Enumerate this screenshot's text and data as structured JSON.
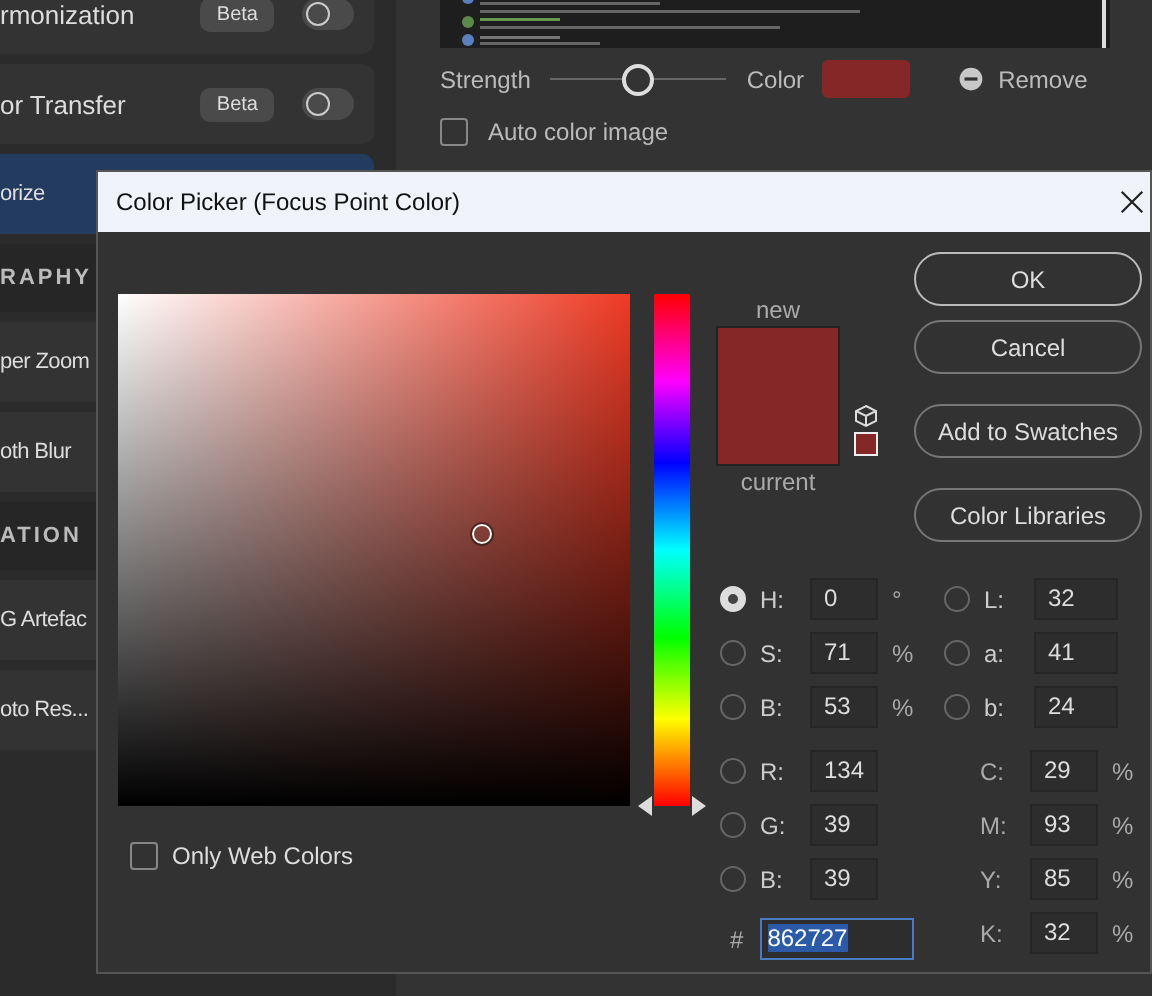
{
  "sidebar": {
    "items": [
      {
        "kind": "filter",
        "label": "rmonization",
        "badge": "Beta",
        "on": false,
        "selected": false
      },
      {
        "kind": "filter",
        "label": "or Transfer",
        "badge": "Beta",
        "on": false,
        "selected": false
      },
      {
        "kind": "filter",
        "label": "orize",
        "selected": true
      },
      {
        "kind": "header",
        "label": "RAPHY"
      },
      {
        "kind": "filter",
        "label": "per Zoom",
        "selected": false
      },
      {
        "kind": "filter",
        "label": "oth Blur",
        "selected": false
      },
      {
        "kind": "header",
        "label": "ATION"
      },
      {
        "kind": "filter",
        "label": "G Artefac",
        "selected": false
      },
      {
        "kind": "filter",
        "label": "oto Res...",
        "selected": false
      }
    ]
  },
  "panel": {
    "strength": {
      "label": "Strength",
      "level": 0.5
    },
    "color": {
      "label": "Color"
    },
    "remove_button": "Remove",
    "auto_color": {
      "label": "Auto color image",
      "checked": false
    }
  },
  "dialog": {
    "title": "Color Picker (Focus Point Color)",
    "swatch": {
      "new_label": "new",
      "current_label": "current"
    },
    "buttons": [
      {
        "label": "OK",
        "default": true
      },
      {
        "label": "Cancel",
        "default": false
      },
      {
        "label": "Add to Swatches",
        "default": false
      },
      {
        "label": "Color Libraries",
        "default": false
      }
    ],
    "fields_left": [
      {
        "kind": "radio",
        "label": "H:",
        "value": "0",
        "unit": "°",
        "selected": true
      },
      {
        "kind": "radio",
        "label": "S:",
        "value": "71",
        "unit": "%",
        "selected": false
      },
      {
        "kind": "radio",
        "label": "B:",
        "value": "53",
        "unit": "%",
        "selected": false
      },
      {
        "kind": "radio",
        "label": "R:",
        "value": "134",
        "selected": false
      },
      {
        "kind": "radio",
        "label": "G:",
        "value": "39",
        "selected": false
      },
      {
        "kind": "radio",
        "label": "B:",
        "value": "39",
        "selected": false
      }
    ],
    "fields_right": [
      {
        "kind": "radio",
        "label": "L:",
        "value": "32",
        "selected": false
      },
      {
        "kind": "radio",
        "label": "a:",
        "value": "41",
        "selected": false
      },
      {
        "kind": "radio",
        "label": "b:",
        "value": "24",
        "selected": false
      },
      {
        "kind": "plain",
        "label": "C:",
        "value": "29",
        "unit": "%"
      },
      {
        "kind": "plain",
        "label": "M:",
        "value": "93",
        "unit": "%"
      },
      {
        "kind": "plain",
        "label": "Y:",
        "value": "85",
        "unit": "%"
      },
      {
        "kind": "plain",
        "label": "K:",
        "value": "32",
        "unit": "%"
      }
    ],
    "hex": {
      "label": "#",
      "value": "862727"
    },
    "web_colors": {
      "label": "Only Web Colors",
      "checked": false
    }
  }
}
